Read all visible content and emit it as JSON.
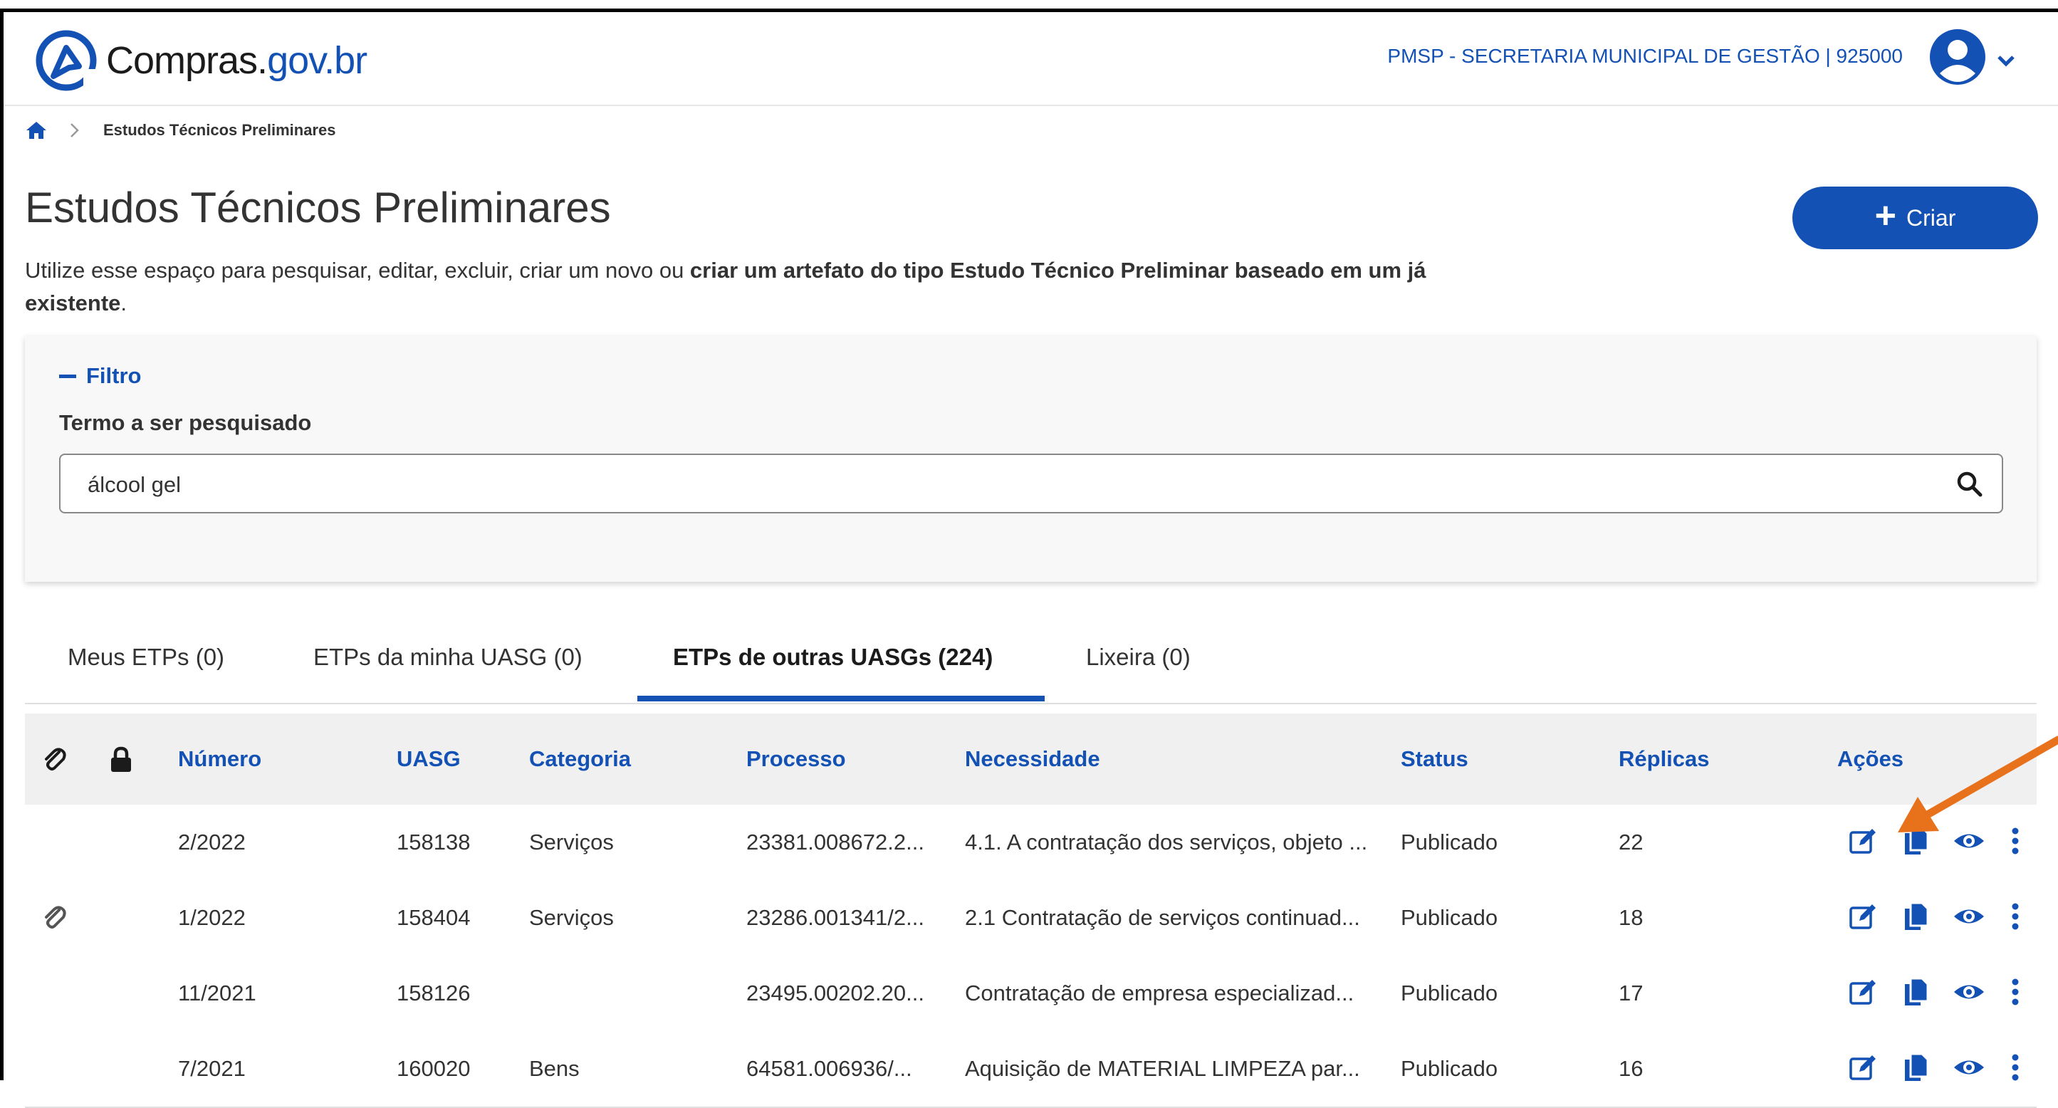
{
  "header": {
    "logo_main": "Compras.",
    "logo_tld": "gov.br",
    "organization": "PMSP - SECRETARIA MUNICIPAL DE GESTÃO | 925000"
  },
  "breadcrumb": {
    "current": "Estudos Técnicos Preliminares"
  },
  "page": {
    "title": "Estudos Técnicos Preliminares",
    "description_plain": "Utilize esse espaço para pesquisar, editar, excluir, criar um novo ou ",
    "description_bold": "criar um artefato do tipo Estudo Técnico Preliminar baseado em um já existente",
    "description_end": ".",
    "create_label": "Criar"
  },
  "filter": {
    "toggle_label": "Filtro",
    "search_label": "Termo a ser pesquisado",
    "search_value": "álcool gel"
  },
  "tabs": [
    {
      "label": "Meus ETPs (0)"
    },
    {
      "label": "ETPs da minha UASG (0)"
    },
    {
      "label": "ETPs de outras UASGs (224)"
    },
    {
      "label": "Lixeira (0)"
    }
  ],
  "table": {
    "columns": {
      "numero": "Número",
      "uasg": "UASG",
      "categoria": "Categoria",
      "processo": "Processo",
      "necessidade": "Necessidade",
      "status": "Status",
      "replicas": "Réplicas",
      "acoes": "Ações"
    },
    "rows": [
      {
        "numero": "2/2022",
        "uasg": "158138",
        "categoria": "Serviços",
        "processo": "23381.008672.2...",
        "necessidade": "4.1. A contratação dos serviços, objeto ...",
        "status": "Publicado",
        "replicas": "22"
      },
      {
        "numero": "1/2022",
        "uasg": "158404",
        "categoria": "Serviços",
        "processo": "23286.001341/2...",
        "necessidade": "2.1 Contratação de serviços continuad...",
        "status": "Publicado",
        "replicas": "18"
      },
      {
        "numero": "11/2021",
        "uasg": "158126",
        "categoria": "",
        "processo": "23495.00202.20...",
        "necessidade": "Contratação de empresa especializad...",
        "status": "Publicado",
        "replicas": "17"
      },
      {
        "numero": "7/2021",
        "uasg": "160020",
        "categoria": "Bens",
        "processo": "64581.006936/...",
        "necessidade": "Aquisição de MATERIAL LIMPEZA par...",
        "status": "Publicado",
        "replicas": "16"
      }
    ]
  },
  "colors": {
    "primary": "#1351b4",
    "arrow": "#e8711c",
    "text": "#333333"
  }
}
